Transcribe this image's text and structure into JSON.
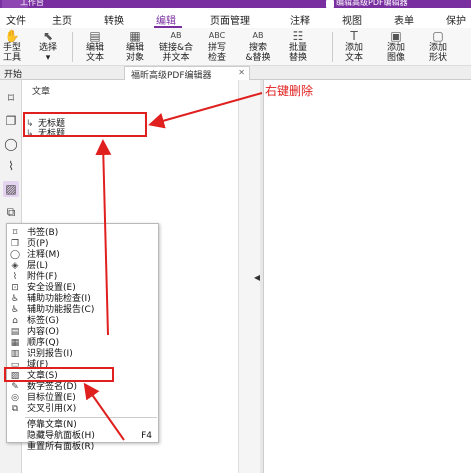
{
  "titlebar": {
    "title": "工作台",
    "doc_title": "编辑高级PDF编辑器"
  },
  "menu": [
    "文件",
    "主页",
    "转换",
    "编辑",
    "页面管理",
    "注释",
    "视图",
    "表单",
    "保护"
  ],
  "ribbon": {
    "buttons": [
      {
        "label1": "手型",
        "label2": "工具"
      },
      {
        "label1": "选择",
        "label2": ""
      },
      {
        "label1": "编辑",
        "label2": "文本"
      },
      {
        "label1": "编辑",
        "label2": "对象"
      },
      {
        "label1": "链接&合",
        "label2": "并文本"
      },
      {
        "label1": "拼写",
        "label2": "检查"
      },
      {
        "label1": "搜索",
        "label2": "&替换"
      },
      {
        "label1": "批量",
        "label2": "替换"
      },
      {
        "label1": "添加",
        "label2": "文本"
      },
      {
        "label1": "添加",
        "label2": "图像"
      },
      {
        "label1": "添加",
        "label2": "形状"
      }
    ]
  },
  "tabs": {
    "start": "开始",
    "doc": "福昕高级PDF编辑器"
  },
  "panel": {
    "title": "文章",
    "items": [
      "无标题",
      "无标题"
    ]
  },
  "annotation": {
    "text": "右键删除"
  },
  "context_menu": {
    "items": [
      {
        "label": "书签",
        "key": "B"
      },
      {
        "label": "页",
        "key": "P"
      },
      {
        "label": "注释",
        "key": "M"
      },
      {
        "label": "层",
        "key": "L"
      },
      {
        "label": "附件",
        "key": "F"
      },
      {
        "label": "安全设置",
        "key": "E"
      },
      {
        "label": "辅助功能检查",
        "key": "I"
      },
      {
        "label": "辅助功能报告",
        "key": "C"
      },
      {
        "label": "标签",
        "key": "G"
      },
      {
        "label": "内容",
        "key": "O"
      },
      {
        "label": "顺序",
        "key": "Q"
      },
      {
        "label": "识别报告",
        "key": "I"
      },
      {
        "label": "域",
        "key": "F"
      },
      {
        "label": "文章",
        "key": "S"
      },
      {
        "label": "数字签名",
        "key": "D"
      },
      {
        "label": "目标位置",
        "key": "E"
      },
      {
        "label": "交叉引用",
        "key": "X"
      }
    ],
    "extra": [
      {
        "label": "停靠文章",
        "key": "N",
        "shortcut": ""
      },
      {
        "label": "隐藏导航面板",
        "key": "H",
        "shortcut": "F4"
      },
      {
        "label": "重置所有面板",
        "key": "R",
        "shortcut": ""
      }
    ]
  }
}
